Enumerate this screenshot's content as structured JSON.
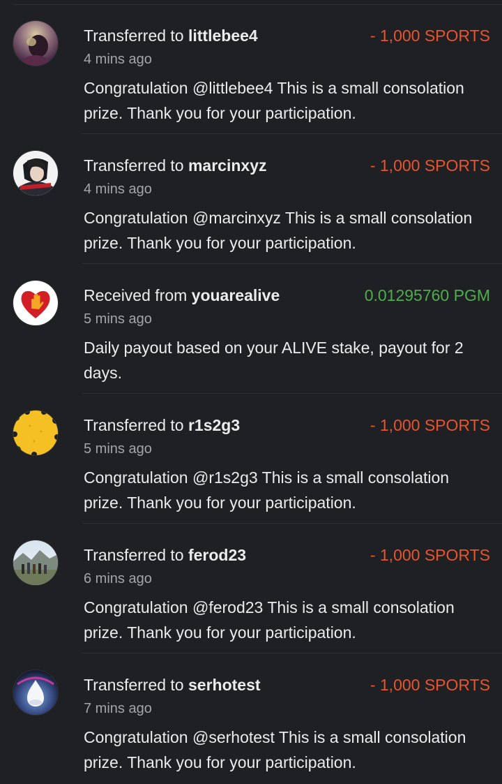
{
  "transactions": [
    {
      "avatar": "avatar-littlebee4",
      "direction_label": "Transferred to",
      "counterparty": "littlebee4",
      "amount": "- 1,000 SPORTS",
      "amount_type": "out",
      "time": "4 mins ago",
      "memo": "Congratulation @littlebee4 This is a small consolation prize. Thank you for your participation."
    },
    {
      "avatar": "avatar-marcinxyz",
      "direction_label": "Transferred to",
      "counterparty": "marcinxyz",
      "amount": "- 1,000 SPORTS",
      "amount_type": "out",
      "time": "4 mins ago",
      "memo": "Congratulation @marcinxyz This is a small consolation prize. Thank you for your participation."
    },
    {
      "avatar": "heart-hand-icon",
      "direction_label": "Received from",
      "counterparty": "youarealive",
      "amount": "0.01295760 PGM",
      "amount_type": "in",
      "time": "5 mins ago",
      "memo": "Daily payout based on your ALIVE stake, payout for 2 days."
    },
    {
      "avatar": "avatar-r1s2g3",
      "direction_label": "Transferred to",
      "counterparty": "r1s2g3",
      "amount": "- 1,000 SPORTS",
      "amount_type": "out",
      "time": "5 mins ago",
      "memo": "Congratulation @r1s2g3 This is a small consolation prize. Thank you for your participation."
    },
    {
      "avatar": "avatar-ferod23",
      "direction_label": "Transferred to",
      "counterparty": "ferod23",
      "amount": "- 1,000 SPORTS",
      "amount_type": "out",
      "time": "6 mins ago",
      "memo": "Congratulation @ferod23 This is a small consolation prize. Thank you for your participation."
    },
    {
      "avatar": "avatar-serhotest",
      "direction_label": "Transferred to",
      "counterparty": "serhotest",
      "amount": "- 1,000 SPORTS",
      "amount_type": "out",
      "time": "7 mins ago",
      "memo": "Congratulation @serhotest This is a small consolation prize. Thank you for your participation."
    }
  ],
  "colors": {
    "background": "#1f2023",
    "outgoing_amount": "#e8542c",
    "incoming_amount": "#4cae4c",
    "secondary_text": "#a4a5a8"
  }
}
